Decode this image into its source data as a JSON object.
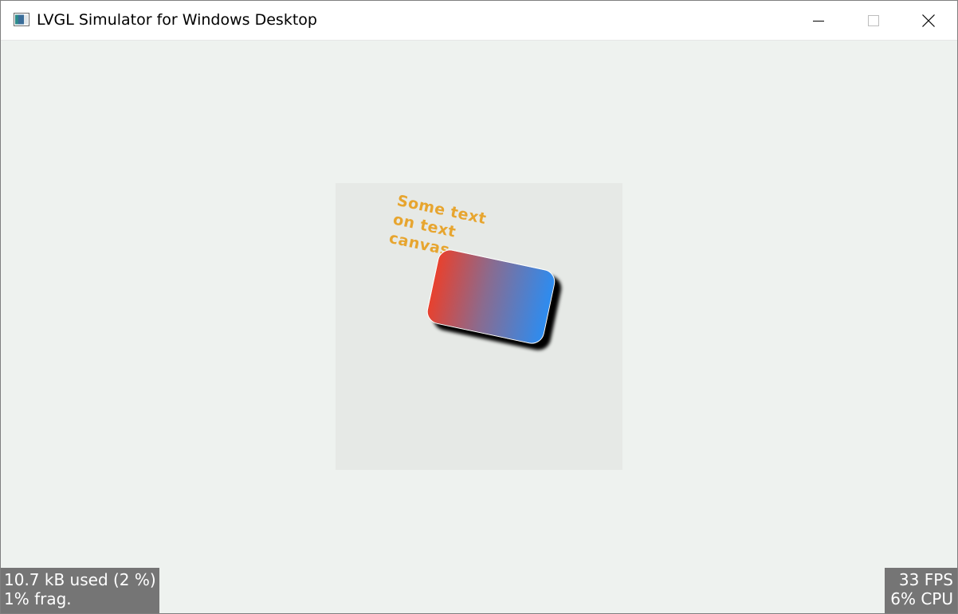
{
  "window": {
    "title": "LVGL Simulator for Windows Desktop",
    "icon": "app-window-icon",
    "controls": {
      "minimize_icon": "minimize-icon",
      "maximize_icon": "maximize-icon",
      "close_icon": "close-icon"
    }
  },
  "canvas": {
    "text": "Some text\non text\ncanvas",
    "text_color": "#e8a020",
    "gradient_start": "#e8412e",
    "gradient_end": "#2d8cf0",
    "background": "#e6e9e6"
  },
  "monitors": {
    "memory": {
      "used": "10.7 kB used (2 %)",
      "frag": "1% frag."
    },
    "performance": {
      "fps": "33 FPS",
      "cpu": "6% CPU"
    }
  },
  "colors": {
    "screen_bg": "#eef2ef",
    "monitor_bg": "#757575"
  }
}
